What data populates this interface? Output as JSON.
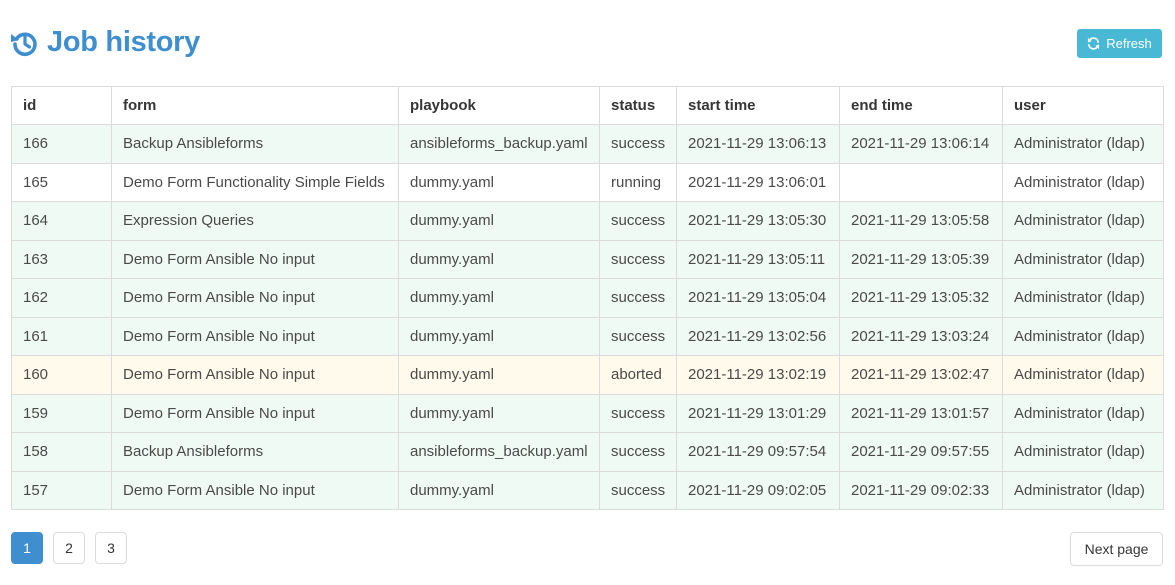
{
  "header": {
    "title": "Job history",
    "refresh_label": "Refresh",
    "title_color": "#3e8ed0",
    "refresh_color": "#48b8d4"
  },
  "table": {
    "columns": [
      "id",
      "form",
      "playbook",
      "status",
      "start time",
      "end time",
      "user"
    ],
    "rows": [
      {
        "id": "166",
        "form": "Backup Ansibleforms",
        "playbook": "ansibleforms_backup.yaml",
        "status": "success",
        "start": "2021-11-29 13:06:13",
        "end": "2021-11-29 13:06:14",
        "user": "Administrator (ldap)"
      },
      {
        "id": "165",
        "form": "Demo Form Functionality Simple Fields",
        "playbook": "dummy.yaml",
        "status": "running",
        "start": "2021-11-29 13:06:01",
        "end": "",
        "user": "Administrator (ldap)"
      },
      {
        "id": "164",
        "form": "Expression Queries",
        "playbook": "dummy.yaml",
        "status": "success",
        "start": "2021-11-29 13:05:30",
        "end": "2021-11-29 13:05:58",
        "user": "Administrator (ldap)"
      },
      {
        "id": "163",
        "form": "Demo Form Ansible No input",
        "playbook": "dummy.yaml",
        "status": "success",
        "start": "2021-11-29 13:05:11",
        "end": "2021-11-29 13:05:39",
        "user": "Administrator (ldap)"
      },
      {
        "id": "162",
        "form": "Demo Form Ansible No input",
        "playbook": "dummy.yaml",
        "status": "success",
        "start": "2021-11-29 13:05:04",
        "end": "2021-11-29 13:05:32",
        "user": "Administrator (ldap)"
      },
      {
        "id": "161",
        "form": "Demo Form Ansible No input",
        "playbook": "dummy.yaml",
        "status": "success",
        "start": "2021-11-29 13:02:56",
        "end": "2021-11-29 13:03:24",
        "user": "Administrator (ldap)"
      },
      {
        "id": "160",
        "form": "Demo Form Ansible No input",
        "playbook": "dummy.yaml",
        "status": "aborted",
        "start": "2021-11-29 13:02:19",
        "end": "2021-11-29 13:02:47",
        "user": "Administrator (ldap)"
      },
      {
        "id": "159",
        "form": "Demo Form Ansible No input",
        "playbook": "dummy.yaml",
        "status": "success",
        "start": "2021-11-29 13:01:29",
        "end": "2021-11-29 13:01:57",
        "user": "Administrator (ldap)"
      },
      {
        "id": "158",
        "form": "Backup Ansibleforms",
        "playbook": "ansibleforms_backup.yaml",
        "status": "success",
        "start": "2021-11-29 09:57:54",
        "end": "2021-11-29 09:57:55",
        "user": "Administrator (ldap)"
      },
      {
        "id": "157",
        "form": "Demo Form Ansible No input",
        "playbook": "dummy.yaml",
        "status": "success",
        "start": "2021-11-29 09:02:05",
        "end": "2021-11-29 09:02:33",
        "user": "Administrator (ldap)"
      }
    ]
  },
  "pagination": {
    "pages": [
      "1",
      "2",
      "3"
    ],
    "current": "1",
    "next_label": "Next page"
  },
  "icons": {
    "title_icon": "history-icon",
    "refresh_icon": "refresh-icon"
  }
}
